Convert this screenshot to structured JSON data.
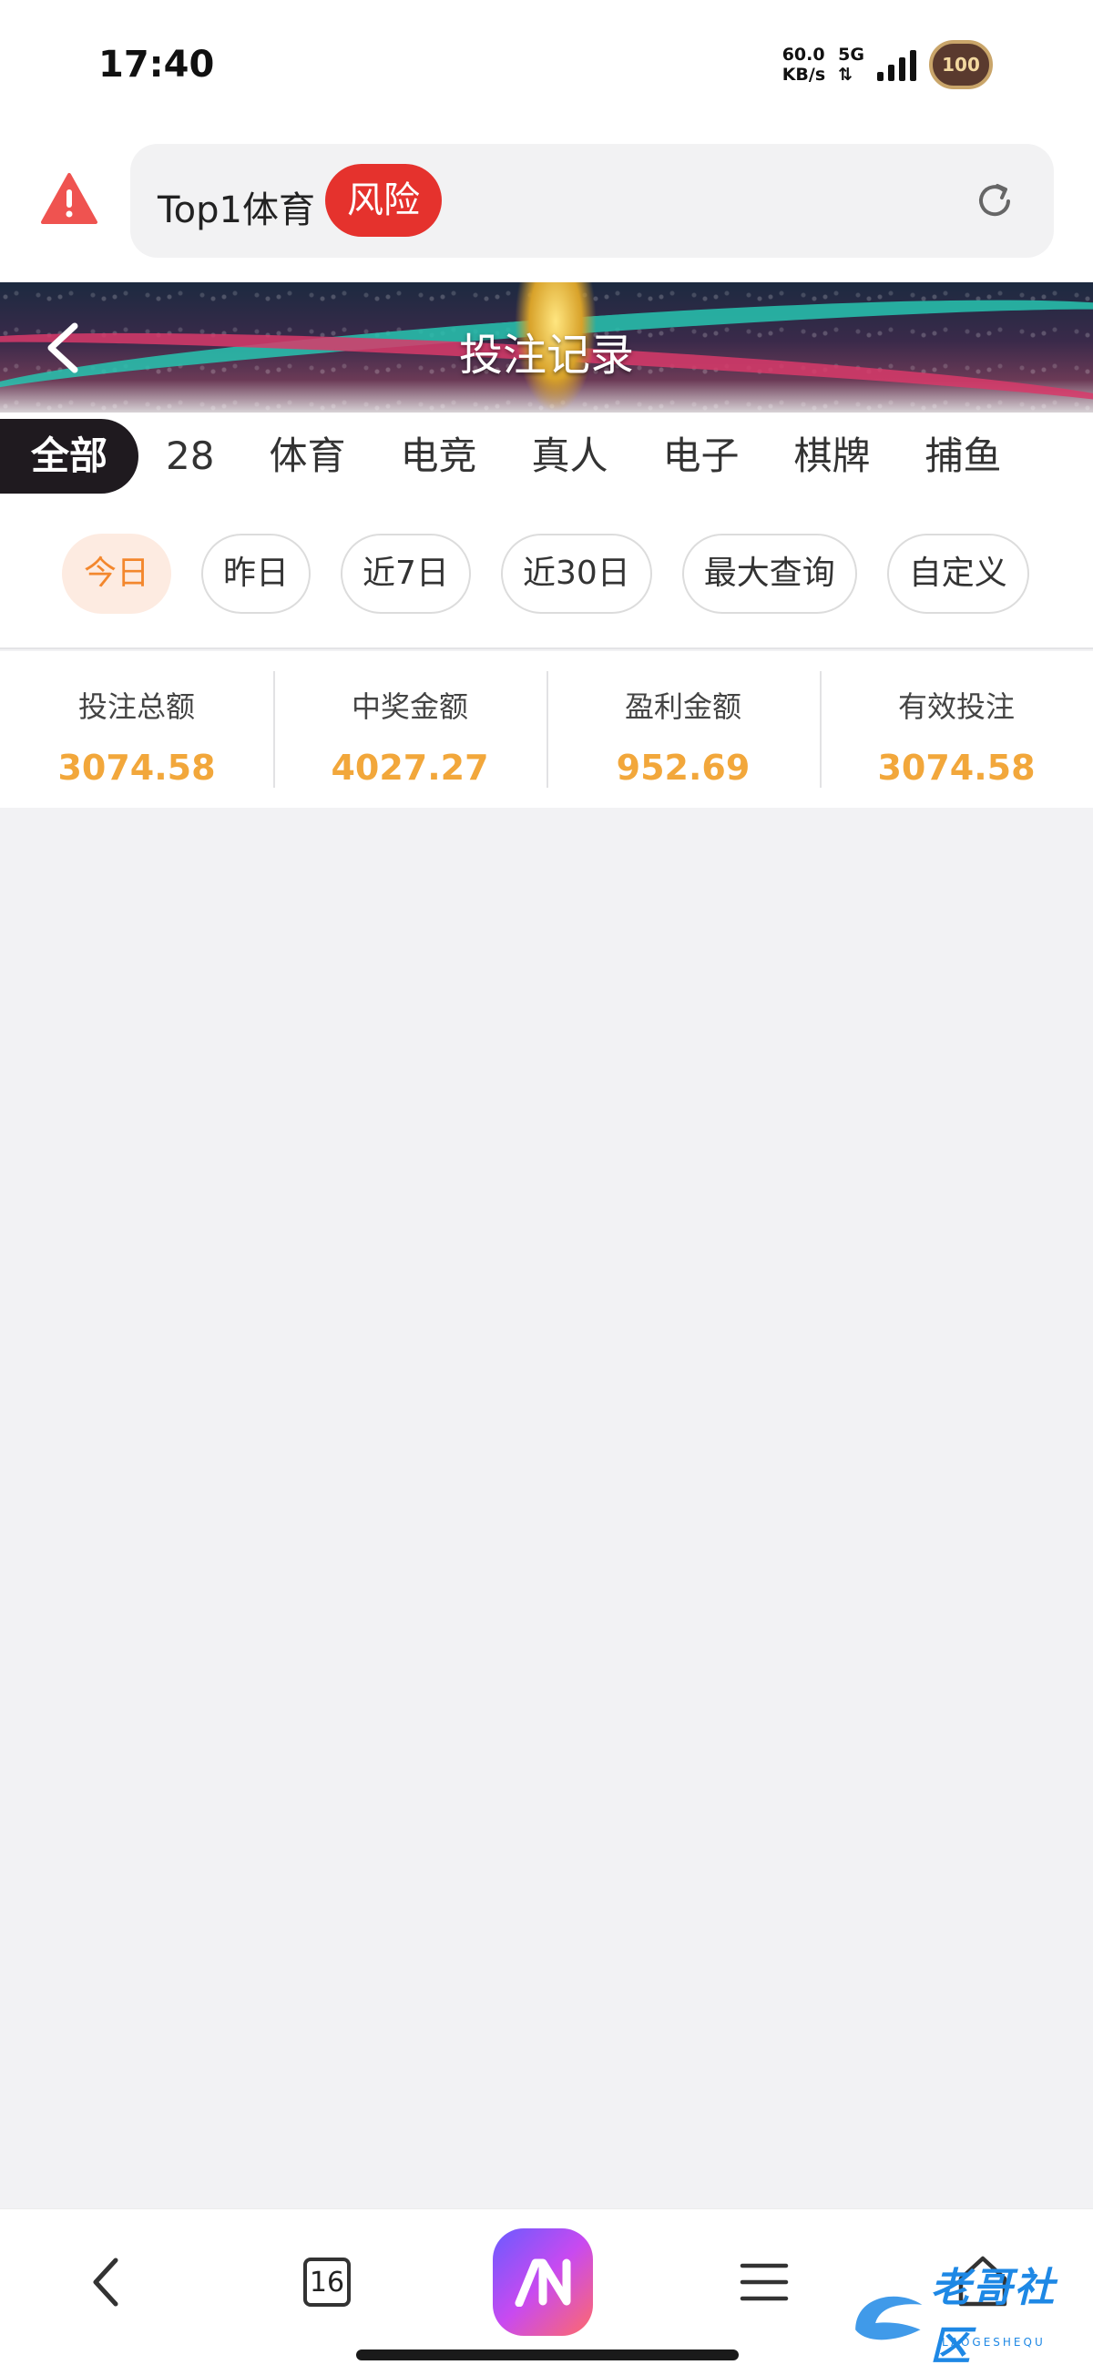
{
  "status_bar": {
    "time": "17:40",
    "net_speed_value": "60.0",
    "net_speed_unit": "KB/s",
    "network_gen": "5G",
    "battery_label": "100"
  },
  "url_bar": {
    "site_title": "Top1体育",
    "risk_label": "风险"
  },
  "header": {
    "title": "投注记录"
  },
  "category_tabs": [
    {
      "label": "全部",
      "active": true
    },
    {
      "label": "28"
    },
    {
      "label": "体育"
    },
    {
      "label": "电竞"
    },
    {
      "label": "真人"
    },
    {
      "label": "电子"
    },
    {
      "label": "棋牌"
    },
    {
      "label": "捕鱼"
    }
  ],
  "date_filters": [
    {
      "label": "今日",
      "active": true
    },
    {
      "label": "昨日"
    },
    {
      "label": "近7日"
    },
    {
      "label": "近30日"
    },
    {
      "label": "最大查询"
    },
    {
      "label": "自定义"
    }
  ],
  "summary": [
    {
      "label": "投注总额",
      "value": "3074.58"
    },
    {
      "label": "中奖金额",
      "value": "4027.27"
    },
    {
      "label": "盈利金额",
      "value": "952.69"
    },
    {
      "label": "有效投注",
      "value": "3074.58"
    }
  ],
  "bottom_bar": {
    "tab_count": "16"
  },
  "watermark": {
    "text": "老哥社区",
    "sub": "LAOGESHEQU"
  },
  "colors": {
    "accent_orange": "#f2a73b",
    "risk_red": "#e5322d",
    "active_chip_bg": "#fdebe1"
  }
}
